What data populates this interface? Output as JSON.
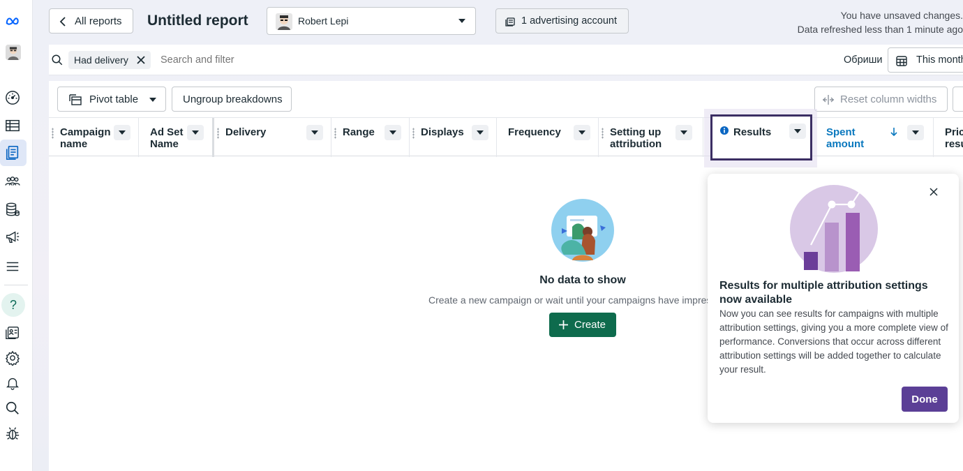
{
  "sidebar": {
    "items": [
      {
        "name": "meta-logo",
        "icon": "meta-logo-icon"
      },
      {
        "name": "avatar",
        "icon": "avatar-icon"
      },
      {
        "name": "dashboard",
        "icon": "gauge-icon"
      },
      {
        "name": "ads-manager",
        "icon": "table-icon"
      },
      {
        "name": "reports",
        "icon": "reports-icon"
      },
      {
        "name": "audiences",
        "icon": "people-icon"
      },
      {
        "name": "data-sources",
        "icon": "database-icon"
      },
      {
        "name": "campaigns",
        "icon": "megaphone-icon"
      },
      {
        "name": "menu",
        "icon": "hamburger-icon"
      },
      {
        "name": "help",
        "icon": "help-icon",
        "label": "?"
      },
      {
        "name": "business-info",
        "icon": "id-card-icon"
      },
      {
        "name": "settings",
        "icon": "gear-icon"
      },
      {
        "name": "notifications",
        "icon": "bell-icon"
      },
      {
        "name": "search",
        "icon": "search-icon"
      },
      {
        "name": "debug",
        "icon": "bug-icon"
      }
    ]
  },
  "header": {
    "back_label": "All reports",
    "title": "Untitled report",
    "account_name": "Robert Lepi",
    "ad_accounts_label": "1 advertising account",
    "unsaved_line1": "You have unsaved changes.",
    "unsaved_line2": "Data refreshed less than 1 minute ago"
  },
  "filter": {
    "chip_label": "Had delivery",
    "search_placeholder": "Search and filter",
    "clear_label": "Обриши",
    "date_label": "This month"
  },
  "toolbar": {
    "pivot_label": "Pivot table",
    "ungroup_label": "Ungroup breakdowns",
    "reset_label": "Reset column widths"
  },
  "columns": [
    {
      "line1": "Campaign",
      "line2": "name"
    },
    {
      "line1": "Ad Set",
      "line2": "Name"
    },
    {
      "line1": "Delivery",
      "line2": ""
    },
    {
      "line1": "Range",
      "line2": ""
    },
    {
      "line1": "Displays",
      "line2": ""
    },
    {
      "line1": "Frequency",
      "line2": ""
    },
    {
      "line1": "Setting up",
      "line2": "attribution"
    },
    {
      "line1": "Results",
      "line2": ""
    },
    {
      "line1": "Spent",
      "line2": "amount"
    },
    {
      "line1": "Pric",
      "line2": "resu"
    }
  ],
  "empty_state": {
    "title": "No data to show",
    "subtitle": "Create a new campaign or wait until your campaigns have impressions.",
    "create_label": "Create"
  },
  "popup": {
    "title": "Results for multiple attribution settings now available",
    "body": "Now you can see results for campaigns with multiple attribution settings, giving you a more complete view of performance. Conversions that occur across different attribution settings will be added together to calculate your result.",
    "done_label": "Done"
  },
  "colors": {
    "accent_blue": "#0a78be",
    "create_green": "#0e6b4d",
    "done_purple": "#5b3f96",
    "results_border": "#3b2e63"
  }
}
